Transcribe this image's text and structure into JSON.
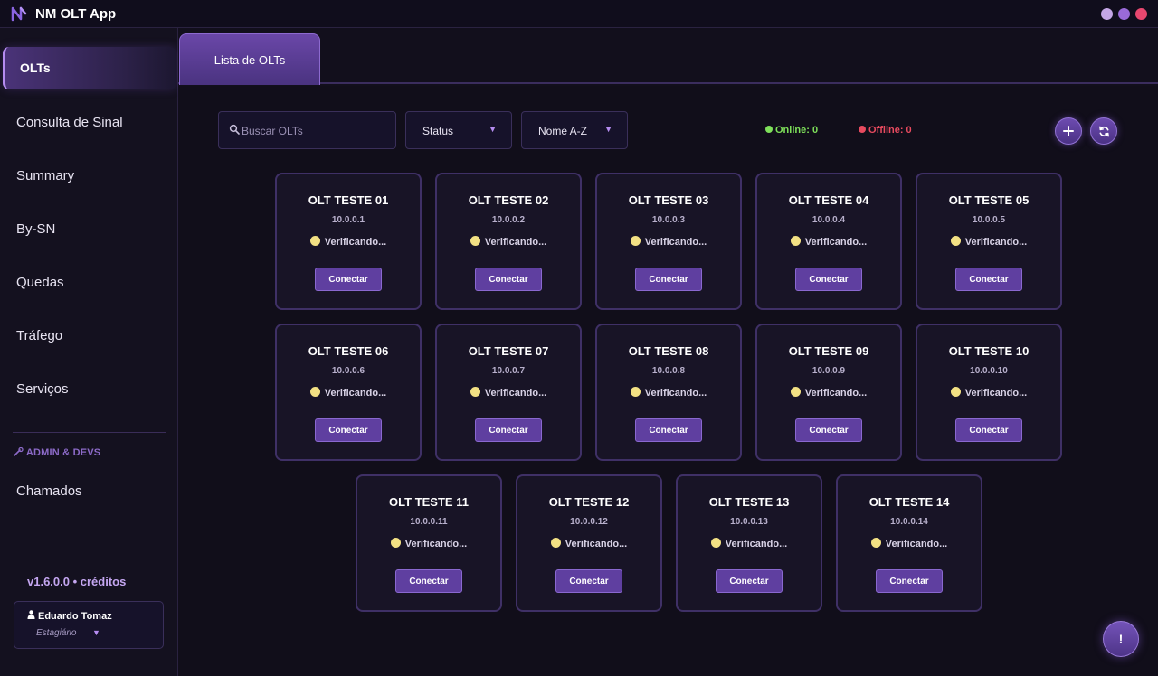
{
  "window": {
    "title": "NM OLT App",
    "logo_icon": "app-logo-icon"
  },
  "sidebar": {
    "items": [
      {
        "label": "OLTs",
        "active": true
      },
      {
        "label": "Consulta de Sinal"
      },
      {
        "label": "Summary"
      },
      {
        "label": "By-SN"
      },
      {
        "label": "Quedas"
      },
      {
        "label": "Tráfego"
      },
      {
        "label": "Serviços"
      }
    ],
    "admin_section": "ADMIN & DEVS",
    "admin_items": [
      {
        "label": "Chamados"
      }
    ],
    "version": "v1.6.0.0 • créditos",
    "user": {
      "name": "Eduardo Tomaz",
      "role": "Estagiário"
    }
  },
  "tabs": [
    {
      "label": "Lista de OLTs",
      "active": true
    }
  ],
  "toolbar": {
    "search_placeholder": "Buscar OLTs",
    "status_filter": "Status",
    "sort": "Nome A-Z",
    "online": "Online: 0",
    "offline": "Offline: 0",
    "add_icon": "plus-icon",
    "refresh_icon": "refresh-icon"
  },
  "colors": {
    "accent": "#6a47a8",
    "online": "#7ee05a",
    "offline": "#e84a5f",
    "checking": "#f3e184"
  },
  "olts": [
    {
      "name": "OLT TESTE 01",
      "ip": "10.0.0.1",
      "status": "Verificando...",
      "action": "Conectar"
    },
    {
      "name": "OLT TESTE 02",
      "ip": "10.0.0.2",
      "status": "Verificando...",
      "action": "Conectar"
    },
    {
      "name": "OLT TESTE 03",
      "ip": "10.0.0.3",
      "status": "Verificando...",
      "action": "Conectar"
    },
    {
      "name": "OLT TESTE 04",
      "ip": "10.0.0.4",
      "status": "Verificando...",
      "action": "Conectar"
    },
    {
      "name": "OLT TESTE 05",
      "ip": "10.0.0.5",
      "status": "Verificando...",
      "action": "Conectar"
    },
    {
      "name": "OLT TESTE 06",
      "ip": "10.0.0.6",
      "status": "Verificando...",
      "action": "Conectar"
    },
    {
      "name": "OLT TESTE 07",
      "ip": "10.0.0.7",
      "status": "Verificando...",
      "action": "Conectar"
    },
    {
      "name": "OLT TESTE 08",
      "ip": "10.0.0.8",
      "status": "Verificando...",
      "action": "Conectar"
    },
    {
      "name": "OLT TESTE 09",
      "ip": "10.0.0.9",
      "status": "Verificando...",
      "action": "Conectar"
    },
    {
      "name": "OLT TESTE 10",
      "ip": "10.0.0.10",
      "status": "Verificando...",
      "action": "Conectar"
    },
    {
      "name": "OLT TESTE 11",
      "ip": "10.0.0.11",
      "status": "Verificando...",
      "action": "Conectar"
    },
    {
      "name": "OLT TESTE 12",
      "ip": "10.0.0.12",
      "status": "Verificando...",
      "action": "Conectar"
    },
    {
      "name": "OLT TESTE 13",
      "ip": "10.0.0.13",
      "status": "Verificando...",
      "action": "Conectar"
    },
    {
      "name": "OLT TESTE 14",
      "ip": "10.0.0.14",
      "status": "Verificando...",
      "action": "Conectar"
    }
  ],
  "help_button": "!"
}
